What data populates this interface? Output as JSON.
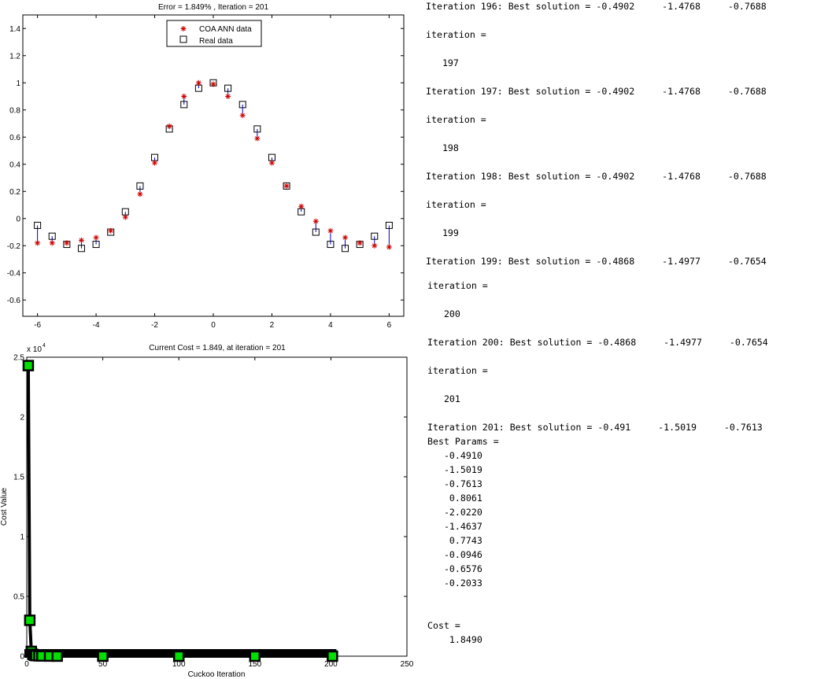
{
  "chart_data": [
    {
      "type": "scatter",
      "title": "Error = 1.849% ,  Iteration = 201",
      "xlabel": "",
      "ylabel": "",
      "xlim": [
        -6.5,
        6.5
      ],
      "ylim": [
        -0.72,
        1.5
      ],
      "xticks": [
        "-6",
        "-4",
        "-2",
        "0",
        "2",
        "4",
        "6"
      ],
      "yticks": [
        "-0.6",
        "-0.4",
        "-0.2",
        "0",
        "0.2",
        "0.4",
        "0.6",
        "0.8",
        "1",
        "1.2",
        "1.4"
      ],
      "legend": {
        "placement": "top-center",
        "entries": [
          "COA ANN data",
          "Real data"
        ]
      },
      "grid": false,
      "x": [
        -6,
        -5.5,
        -5,
        -4.5,
        -4,
        -3.5,
        -3,
        -2.5,
        -2,
        -1.5,
        -1,
        -0.5,
        0,
        0.5,
        1,
        1.5,
        2,
        2.5,
        3,
        3.5,
        4,
        4.5,
        5,
        5.5,
        6
      ],
      "series": [
        {
          "name": "COA ANN data",
          "marker": "asterisk",
          "color": "#cc0000",
          "values": [
            -0.18,
            -0.18,
            -0.18,
            -0.16,
            -0.14,
            -0.09,
            0.01,
            0.18,
            0.41,
            0.68,
            0.9,
            1.0,
            0.99,
            0.9,
            0.76,
            0.59,
            0.41,
            0.24,
            0.09,
            -0.02,
            -0.09,
            -0.14,
            -0.18,
            -0.2,
            -0.21
          ]
        },
        {
          "name": "Real data",
          "marker": "square",
          "color": "#000000",
          "values": [
            -0.05,
            -0.13,
            -0.19,
            -0.22,
            -0.19,
            -0.1,
            0.05,
            0.24,
            0.45,
            0.66,
            0.84,
            0.96,
            1.0,
            0.96,
            0.84,
            0.66,
            0.45,
            0.24,
            0.05,
            -0.1,
            -0.19,
            -0.22,
            -0.19,
            -0.13,
            -0.05
          ]
        }
      ],
      "error_line_color": "#0000cc"
    },
    {
      "type": "line",
      "title": "Current Cost = 1.849, at iteration = 201",
      "xlabel": "Cuckoo Iteration",
      "ylabel": "Cost Value",
      "exponent_label": "x 10",
      "exponent_power": "4",
      "xlim": [
        0,
        250
      ],
      "ylim": [
        0,
        25000
      ],
      "xticks": [
        "0",
        "50",
        "100",
        "150",
        "200",
        "250"
      ],
      "yticks": [
        "0",
        "0.5",
        "1",
        "1.5",
        "2",
        "2.5"
      ],
      "grid": false,
      "series": [
        {
          "name": "",
          "color": "#000000",
          "marker_face": "#00e000",
          "x": [
            1,
            2,
            3,
            4,
            5,
            6,
            8,
            10,
            15,
            20,
            50,
            100,
            150,
            201
          ],
          "values": [
            24300,
            3000,
            400,
            150,
            80,
            50,
            30,
            20,
            10,
            5,
            3,
            2.5,
            2,
            1.849
          ]
        }
      ]
    }
  ],
  "console": {
    "lines": [
      "Iteration 196: Best solution = -0.4902     -1.4768     -0.7688",
      "iteration =",
      "   197",
      "Iteration 197: Best solution = -0.4902     -1.4768     -0.7688",
      "iteration =",
      "   198",
      "Iteration 198: Best solution = -0.4902     -1.4768     -0.7688",
      "iteration =",
      "   199",
      "Iteration 199: Best solution = -0.4868     -1.4977     -0.7654",
      "iteration =",
      "   200",
      "Iteration 200: Best solution = -0.4868     -1.4977     -0.7654",
      "iteration =",
      "   201",
      "Iteration 201: Best solution = -0.491     -1.5019     -0.7613",
      "Best Params =",
      "   -0.4910",
      "   -1.5019",
      "   -0.7613",
      "    0.8061",
      "   -2.0220",
      "   -1.4637",
      "    0.7743",
      "   -0.0946",
      "   -0.6576",
      "   -0.2033",
      "Cost =",
      "    1.8490"
    ]
  }
}
